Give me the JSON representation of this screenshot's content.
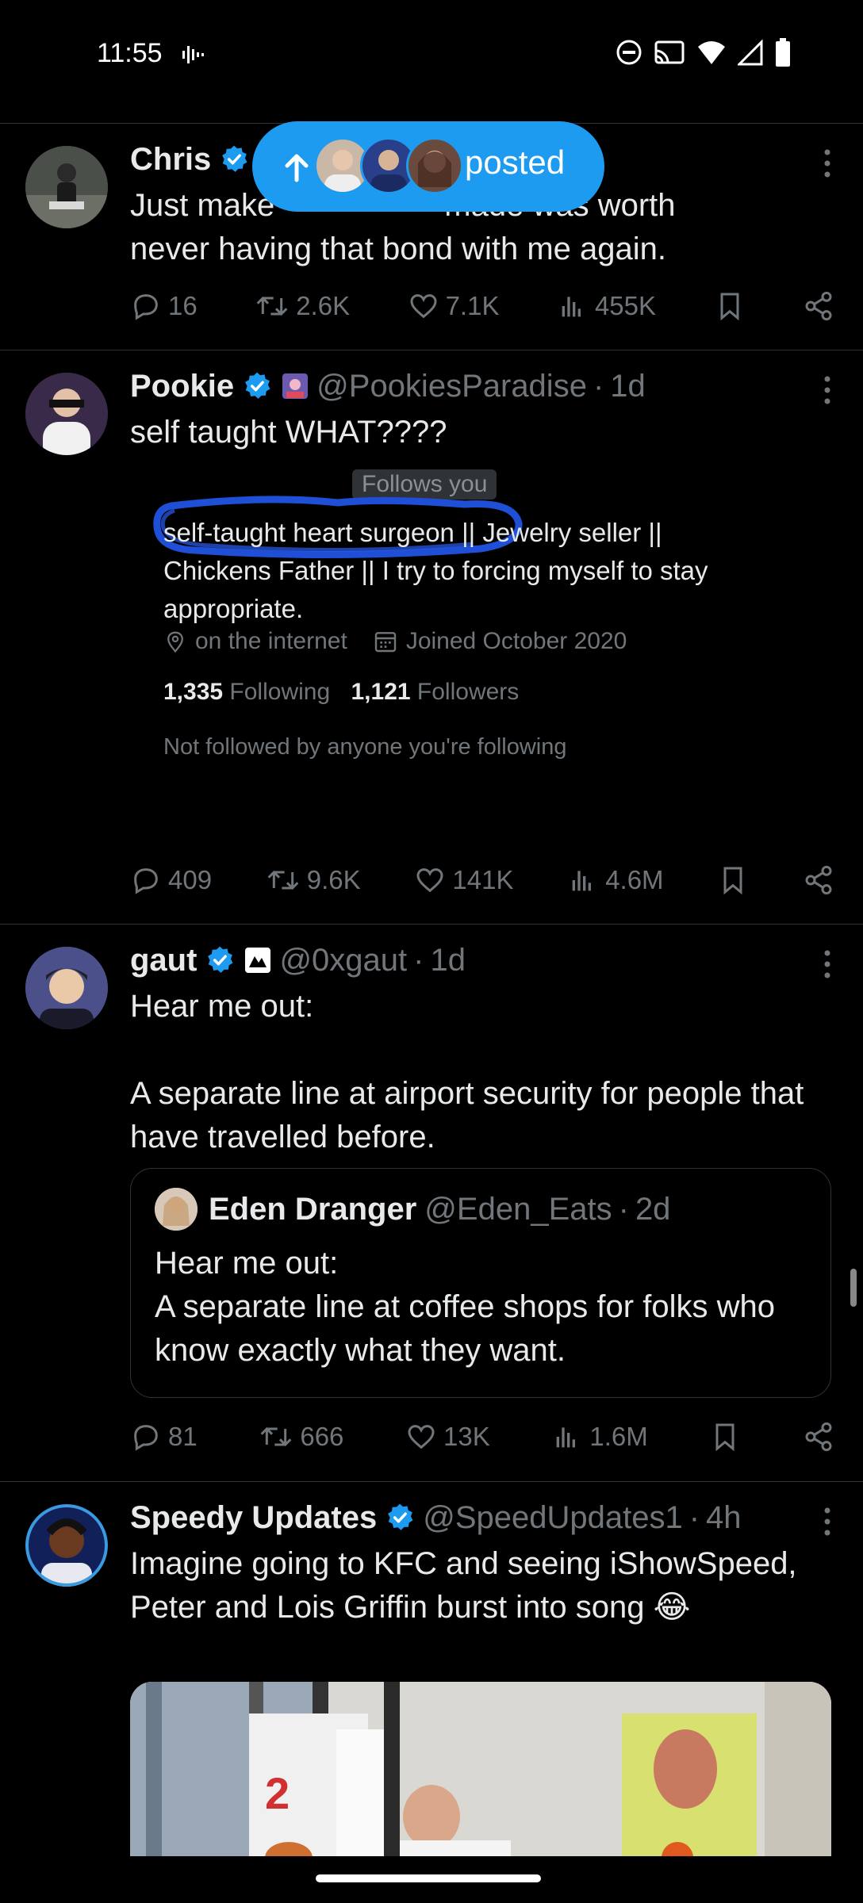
{
  "status": {
    "time": "11:55"
  },
  "pill": {
    "label": "posted"
  },
  "tweets": [
    {
      "name": "Chris",
      "text_visible": "Just make sure that move u made was worth never having that bond with me again.",
      "line1_start": "Just make",
      "line1_end": "made was worth",
      "line2": "never having that bond with me again.",
      "replies": "16",
      "reposts": "2.6K",
      "likes": "7.1K",
      "views": "455K"
    },
    {
      "name": "Pookie",
      "handle": "@PookiesParadise",
      "ago": "1d",
      "text": "self taught WHAT????",
      "bio": {
        "follows_you": "Follows you",
        "line1": "self-taught heart surgeon || Jewelry seller ||",
        "line2": "Chickens Father || I try to forcing myself to stay",
        "line3": "appropriate.",
        "location": "on the internet",
        "joined": "Joined October 2020",
        "following_count": "1,335",
        "following_label": "Following",
        "followers_count": "1,121",
        "followers_label": "Followers",
        "note": "Not followed by anyone you're following"
      },
      "replies": "409",
      "reposts": "9.6K",
      "likes": "141K",
      "views": "4.6M"
    },
    {
      "name": "gaut",
      "handle": "@0xgaut",
      "ago": "1d",
      "text": "Hear me out:\n\nA separate line at airport security for people that have travelled before.",
      "quote": {
        "name": "Eden Dranger",
        "handle": "@Eden_Eats",
        "ago": "2d",
        "text": "Hear me out:\nA separate line at coffee shops for folks who know exactly what they want."
      },
      "replies": "81",
      "reposts": "666",
      "likes": "13K",
      "views": "1.6M"
    },
    {
      "name": "Speedy Updates",
      "handle": "@SpeedUpdates1",
      "ago": "4h",
      "text": "Imagine going to KFC and seeing iShowSpeed, Peter and Lois Griffin burst into song 😂"
    }
  ]
}
